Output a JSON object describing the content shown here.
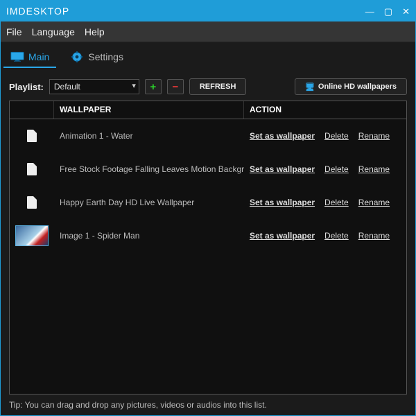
{
  "window": {
    "title": "IMDESKTOP"
  },
  "menu": {
    "file": "File",
    "language": "Language",
    "help": "Help"
  },
  "tabs": {
    "main": "Main",
    "settings": "Settings"
  },
  "toolbar": {
    "playlist_label": "Playlist:",
    "playlist_value": "Default",
    "refresh_label": "REFRESH",
    "online_label": "Online HD wallpapers"
  },
  "table": {
    "header_wallpaper": "WALLPAPER",
    "header_action": "ACTION",
    "action_set": "Set as wallpaper",
    "action_delete": "Delete",
    "action_rename": "Rename",
    "rows": [
      {
        "name": "Animation 1 - Water",
        "thumb": "file"
      },
      {
        "name": "Free Stock Footage Falling Leaves Motion Background",
        "thumb": "file"
      },
      {
        "name": "Happy Earth Day HD Live Wallpaper",
        "thumb": "file"
      },
      {
        "name": "Image 1 - Spider Man",
        "thumb": "image"
      }
    ]
  },
  "tip": "Tip: You can drag and drop any pictures, videos or audios into this list."
}
